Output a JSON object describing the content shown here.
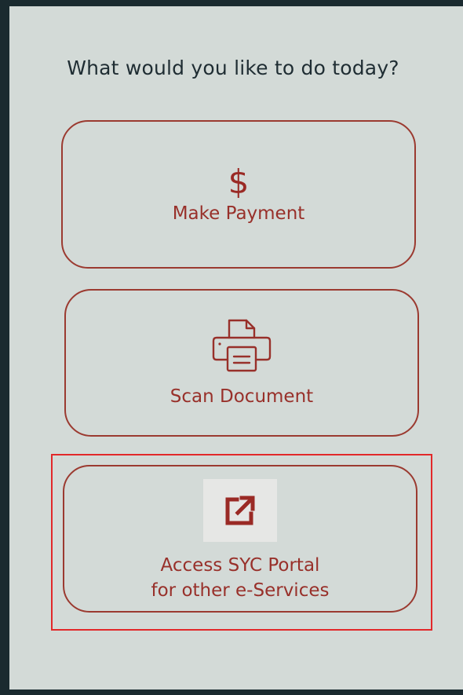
{
  "prompt": "What would you like to do today?",
  "actions": {
    "make_payment": {
      "icon": "dollar-icon",
      "icon_glyph": "$",
      "label": "Make Payment"
    },
    "scan_document": {
      "icon": "printer-icon",
      "label": "Scan Document"
    },
    "access_portal": {
      "icon": "external-link-icon",
      "label_line1": "Access SYC Portal",
      "label_line2": "for other e-Services",
      "highlighted": true
    }
  },
  "colors": {
    "background": "#d3dad7",
    "accent": "#98302a",
    "highlight": "#e2282a",
    "text": "#1f2d33"
  }
}
